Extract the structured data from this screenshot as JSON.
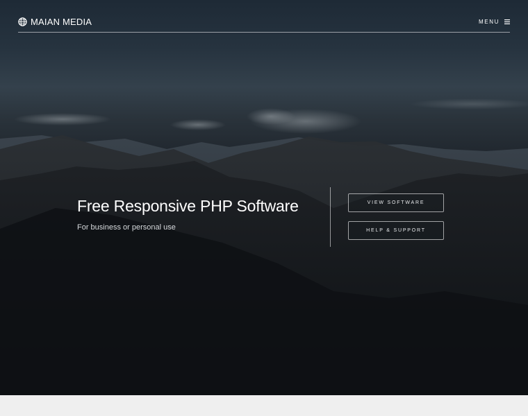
{
  "header": {
    "brand_name": "MAIAN MEDIA",
    "brand_icon": "globe-icon",
    "menu_label": "MENU",
    "menu_icon": "hamburger-icon"
  },
  "hero": {
    "title": "Free Responsive PHP Software",
    "subtitle": "For business or personal use",
    "buttons": [
      {
        "label": "VIEW SOFTWARE"
      },
      {
        "label": "HELP & SUPPORT"
      }
    ]
  },
  "colors": {
    "text_primary": "#ffffff",
    "hero_dark": "#12161b",
    "page_background": "#efefef"
  }
}
